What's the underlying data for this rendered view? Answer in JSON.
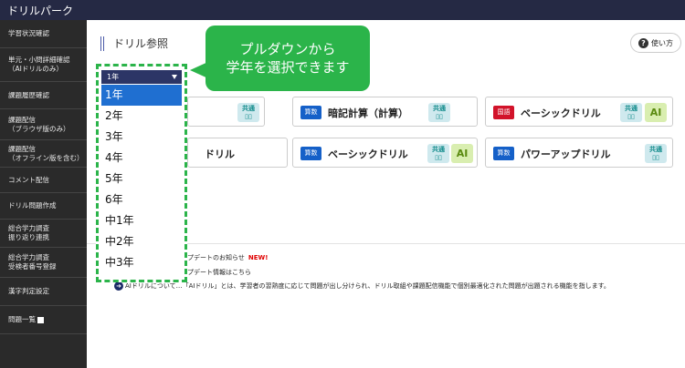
{
  "app_title": "ドリルパーク",
  "sidebar": {
    "items": [
      {
        "label": "学習状況確認"
      },
      {
        "label": "単元・小問詳細確認\n（AIドリルのみ）"
      },
      {
        "label": "課題履歴確認"
      },
      {
        "label": "課題配信\n（ブラウザ版のみ）"
      },
      {
        "label": "課題配信\n（オフライン版を含む）"
      },
      {
        "label": "コメント配信"
      },
      {
        "label": "ドリル問題作成"
      },
      {
        "label": "総合学力調査\n振り返り連携"
      },
      {
        "label": "総合学力調査\n受検者番号登録"
      },
      {
        "label": "漢字判定設定"
      },
      {
        "label": "問題一覧"
      }
    ]
  },
  "page": {
    "title": "ドリル参照",
    "help_label": "使い方",
    "help_icon": "question-icon"
  },
  "callout": {
    "line1": "プルダウンから",
    "line2": "学年を選択できます"
  },
  "grade_select": {
    "selected": "1年",
    "options": [
      "1年",
      "2年",
      "3年",
      "4年",
      "5年",
      "6年",
      "中1年",
      "中2年",
      "中3年"
    ]
  },
  "cards": [
    {
      "badge": "算数",
      "label": "暗記計算（計算）",
      "icon_common": "共通"
    },
    {
      "badge": "国語",
      "label": "ベーシックドリル",
      "icon_common": "共通",
      "icon_ai": "AI"
    },
    {
      "label": "ドリル"
    },
    {
      "badge": "算数",
      "label": "ベーシックドリル",
      "icon_common": "共通",
      "icon_ai": "AI"
    },
    {
      "badge": "算数",
      "label": "パワーアップドリル",
      "icon_common": "共通"
    }
  ],
  "notices": [
    {
      "text": "プデートのお知らせ",
      "badge": "NEW!"
    },
    {
      "text": "プデート情報はこちら"
    },
    {
      "text": "AIドリルについて…「AIドリル」とは、学習者の習熟度に応じて問題が出し分けられ、ドリル取組や課題配信機能で個別最適化された問題が出題される機能を指します。"
    }
  ],
  "colors": {
    "topbar": "#252944",
    "sidebar": "#2a2a2a",
    "callout_green": "#2bb44a",
    "select_blue": "#1f6fd1",
    "badge_blue": "#1560c8",
    "badge_red": "#d2132a"
  }
}
